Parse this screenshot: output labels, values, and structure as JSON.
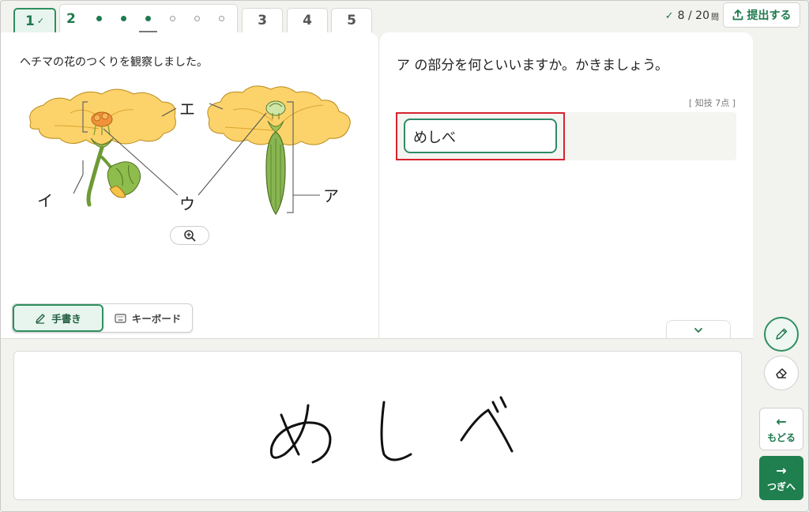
{
  "tabs": {
    "q1": {
      "label": "1",
      "check": "✓"
    },
    "q2": {
      "label": "2",
      "subquestions": [
        "done",
        "done",
        "current",
        "empty",
        "empty",
        "empty"
      ]
    },
    "q3": {
      "label": "3"
    },
    "q4": {
      "label": "4"
    },
    "q5": {
      "label": "5"
    }
  },
  "progress": {
    "check": "✓",
    "text": "8 / 20",
    "unit": "問"
  },
  "submit_label": "提出する",
  "left": {
    "prompt": "ヘチマの花のつくりを観察しました。",
    "labels": {
      "e": "エ",
      "i": "イ",
      "u": "ウ",
      "a": "ア"
    }
  },
  "input_mode": {
    "handwriting": "手書き",
    "keyboard": "キーボード",
    "selected": "handwriting"
  },
  "right": {
    "question": "ア の部分を何といいますか。かきましょう。",
    "points": "[ 知技 7点 ]",
    "answer": "めしべ"
  },
  "handwriting_text": "めしべ",
  "nav": {
    "back": "もどる",
    "next": "つぎへ",
    "back_arrow": "←",
    "next_arrow": "→"
  },
  "colors": {
    "accent": "#1f7a4f",
    "highlight": "#d8222e",
    "petal": "#fcd36a"
  }
}
